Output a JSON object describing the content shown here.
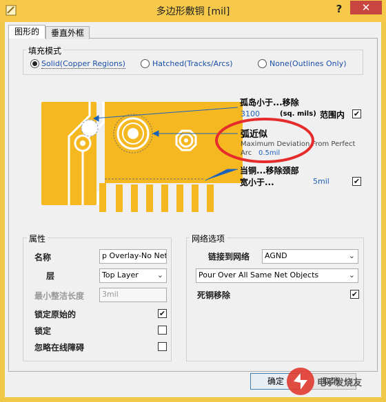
{
  "window": {
    "title": "多边形敷铜 [mil]",
    "help": "?",
    "close": "✕"
  },
  "tabs": [
    {
      "label": "图形的"
    },
    {
      "label": "垂直外框"
    }
  ],
  "fill_mode": {
    "title": "填充模式",
    "options": [
      {
        "label": "Solid(Copper Regions)",
        "selected": true
      },
      {
        "label": "Hatched(Tracks/Arcs)",
        "selected": false
      },
      {
        "label": "None(Outlines Only)",
        "selected": false
      }
    ]
  },
  "diagram": {
    "island": {
      "title": "孤岛小于...移除",
      "value": "3100",
      "unit": "(sq. mils)",
      "range_label": "范围内",
      "checked": true
    },
    "arc": {
      "title": "弧近似",
      "desc": "Maximum Deviation From Perfect",
      "arc_label": "Arc",
      "value": "0.5mil"
    },
    "neck": {
      "title_line1": "当铜...移除颈部",
      "title_line2": "宽小于...",
      "value": "5mil",
      "checked": true
    },
    "colors": {
      "copper": "#f5b820",
      "highlight_ring": "#e52b2b",
      "pointer": "#1c62b9"
    }
  },
  "properties": {
    "title": "属性",
    "name_label": "名称",
    "name_value": "p Overlay-No Net",
    "layer_label": "层",
    "layer_value": "Top Layer",
    "min_len_label": "最小整洁长度",
    "min_len_value": "3mil",
    "lock_primitives_label": "锁定原始的",
    "lock_primitives_checked": true,
    "locked_label": "锁定",
    "locked_checked": false,
    "ignore_label": "忽略在线障碍",
    "ignore_checked": false
  },
  "net_options": {
    "title": "网络选项",
    "connect_label": "链接到网络",
    "connect_value": "AGND",
    "pour_value": "Pour Over All Same Net Objects",
    "remove_dead_label": "死铜移除",
    "remove_dead_checked": true
  },
  "buttons": {
    "ok": "确定",
    "cancel": "取消"
  },
  "watermark": "电子发烧友"
}
